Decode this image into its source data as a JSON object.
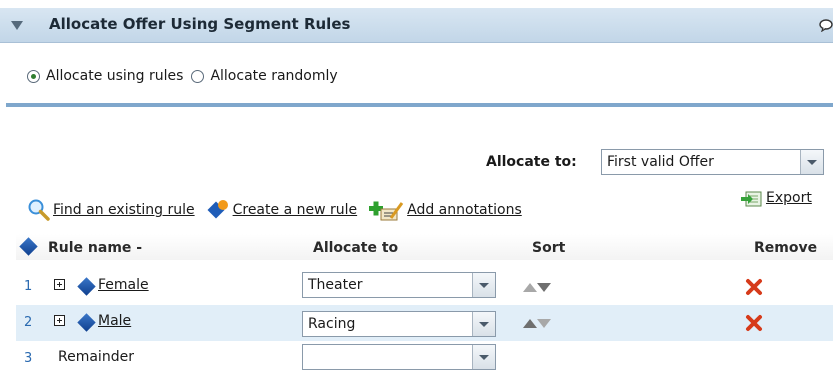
{
  "panel": {
    "title": "Allocate Offer Using Segment Rules"
  },
  "allocation_mode": {
    "options": [
      {
        "label": "Allocate using rules",
        "selected": true
      },
      {
        "label": "Allocate randomly",
        "selected": false
      }
    ]
  },
  "allocate_to": {
    "label": "Allocate to:",
    "value": "First valid Offer"
  },
  "toolbar": {
    "find_label": "Find an existing rule",
    "create_label": "Create a new rule",
    "annotate_label": "Add annotations",
    "export_label": "Export"
  },
  "table": {
    "headers": {
      "rule_name": "Rule name -",
      "allocate_to": "Allocate to",
      "sort": "Sort",
      "remove": "Remove"
    },
    "rows": [
      {
        "num": "1",
        "name": "Female",
        "allocate_to": "Theater"
      },
      {
        "num": "2",
        "name": "Male",
        "allocate_to": "Racing"
      },
      {
        "num": "3",
        "name": "Remainder",
        "allocate_to": ""
      }
    ]
  },
  "colors": {
    "title_bar": "#c9dbeb",
    "separator": "#7fa7cc",
    "alt_row": "#e1eef8",
    "remove_icon": "#d63a1a"
  }
}
